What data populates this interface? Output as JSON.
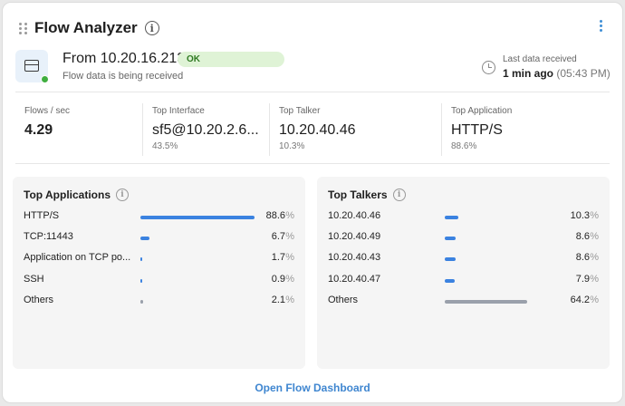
{
  "header": {
    "title": "Flow Analyzer"
  },
  "source": {
    "from": "From 10.20.16.213",
    "status": "OK",
    "subtitle": "Flow data is being received",
    "last_label": "Last data received",
    "last_value": "1 min ago",
    "last_time": "(05:43 PM)"
  },
  "stats": [
    {
      "label": "Flows / sec",
      "value": "4.29",
      "sub": ""
    },
    {
      "label": "Top Interface",
      "value": "sf5@10.20.2.6...",
      "sub": "43.5%"
    },
    {
      "label": "Top Talker",
      "value": "10.20.40.46",
      "sub": "10.3%"
    },
    {
      "label": "Top Application",
      "value": "HTTP/S",
      "sub": "88.6%"
    }
  ],
  "top_applications": {
    "title": "Top Applications",
    "rows": [
      {
        "name": "HTTP/S",
        "percent": "88.6",
        "value": 88.6
      },
      {
        "name": "TCP:11443",
        "percent": "6.7",
        "value": 6.7
      },
      {
        "name": "Application on TCP po...",
        "percent": "1.7",
        "value": 1.7
      },
      {
        "name": "SSH",
        "percent": "0.9",
        "value": 0.9
      },
      {
        "name": "Others",
        "percent": "2.1",
        "value": 2.1
      }
    ]
  },
  "top_talkers": {
    "title": "Top Talkers",
    "rows": [
      {
        "name": "10.20.40.46",
        "percent": "10.3",
        "value": 10.3
      },
      {
        "name": "10.20.40.49",
        "percent": "8.6",
        "value": 8.6
      },
      {
        "name": "10.20.40.43",
        "percent": "8.6",
        "value": 8.6
      },
      {
        "name": "10.20.40.47",
        "percent": "7.9",
        "value": 7.9
      },
      {
        "name": "Others",
        "percent": "64.2",
        "value": 64.2
      }
    ]
  },
  "unit": "%",
  "colors": {
    "accent_bar": "#3b82e0",
    "others_bar": "#9aa0ab",
    "ok_badge": "#dff3d6",
    "link": "#3f86d0",
    "status_dot": "#3fae3f"
  },
  "footer": {
    "link_label": "Open Flow Dashboard"
  },
  "icons": {
    "drag": "drag-handle-icon",
    "info": "info-icon",
    "menu": "kebab-menu-icon",
    "server": "server-icon",
    "clock": "clock-icon"
  }
}
